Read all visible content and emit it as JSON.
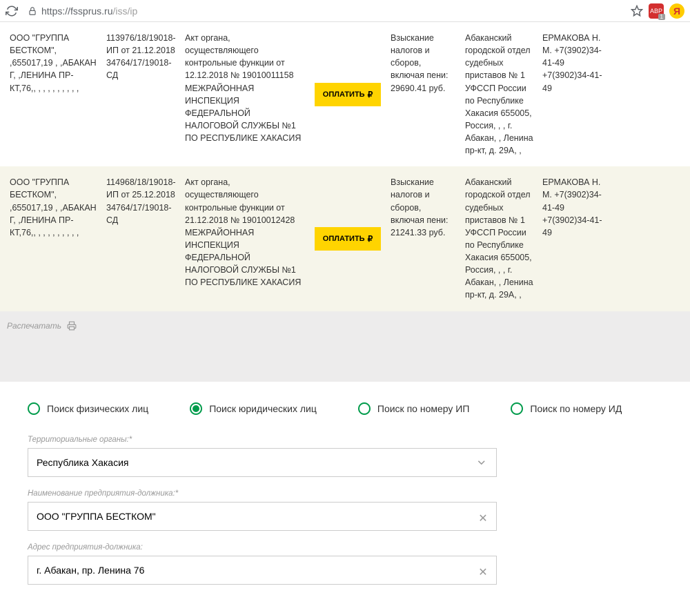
{
  "browser": {
    "url_host": "https://fssprus.ru",
    "url_path": "/iss/ip",
    "ext_badge_text": "ABP",
    "ext_badge_count": "1",
    "yandex_char": "Я"
  },
  "rows": [
    {
      "debtor": "ООО \"ГРУППА БЕСТКОМ\", ,655017,19 , ,АБАКАН Г, ,ЛЕНИНА ПР-КТ,76,, , , , , , , , , ,",
      "case": "113976/18/19018-ИП от 21.12.2018 34764/17/19018-СД",
      "document": "Акт органа, осуществляющего контрольные функции от 12.12.2018 № 19010011158 МЕЖРАЙОННАЯ ИНСПЕКЦИЯ ФЕДЕРАЛЬНОЙ НАЛОГОВОЙ СЛУЖБЫ №1 ПО РЕСПУБЛИКЕ ХАКАСИЯ",
      "pay": "ОПЛАТИТЬ",
      "subject": "Взыскание налогов и сборов, включая пени: 29690.41 руб.",
      "department": "Абаканский городской отдел судебных приставов № 1 УФССП России по Республике Хакасия 655005, Россия, , , г. Абакан, , Ленина пр-кт, д. 29А, ,",
      "officer": "ЕРМАКОВА Н. М. +7(3902)34-41-49 +7(3902)34-41-49"
    },
    {
      "debtor": "ООО \"ГРУППА БЕСТКОМ\", ,655017,19 , ,АБАКАН Г, ,ЛЕНИНА ПР-КТ,76,, , , , , , , , , ,",
      "case": "114968/18/19018-ИП от 25.12.2018 34764/17/19018-СД",
      "document": "Акт органа, осуществляющего контрольные функции от 21.12.2018 № 19010012428 МЕЖРАЙОННАЯ ИНСПЕКЦИЯ ФЕДЕРАЛЬНОЙ НАЛОГОВОЙ СЛУЖБЫ №1 ПО РЕСПУБЛИКЕ ХАКАСИЯ",
      "pay": "ОПЛАТИТЬ",
      "subject": "Взыскание налогов и сборов, включая пени: 21241.33 руб.",
      "department": "Абаканский городской отдел судебных приставов № 1 УФССП России по Республике Хакасия 655005, Россия, , , г. Абакан, , Ленина пр-кт, д. 29А, ,",
      "officer": "ЕРМАКОВА Н. М. +7(3902)34-41-49 +7(3902)34-41-49"
    }
  ],
  "print_label": "Распечатать",
  "search": {
    "tabs": [
      "Поиск физических лиц",
      "Поиск юридических лиц",
      "Поиск по номеру ИП",
      "Поиск по номеру ИД"
    ],
    "selected_tab": 1,
    "region_label": "Территориальные органы:*",
    "region_value": "Республика Хакасия",
    "name_label": "Наименование предприятия-должника:*",
    "name_value": "ООО \"ГРУППА БЕСТКОМ\"",
    "address_label": "Адрес предприятия-должника:",
    "address_value": "г. Абакан, пр. Ленина 76"
  }
}
